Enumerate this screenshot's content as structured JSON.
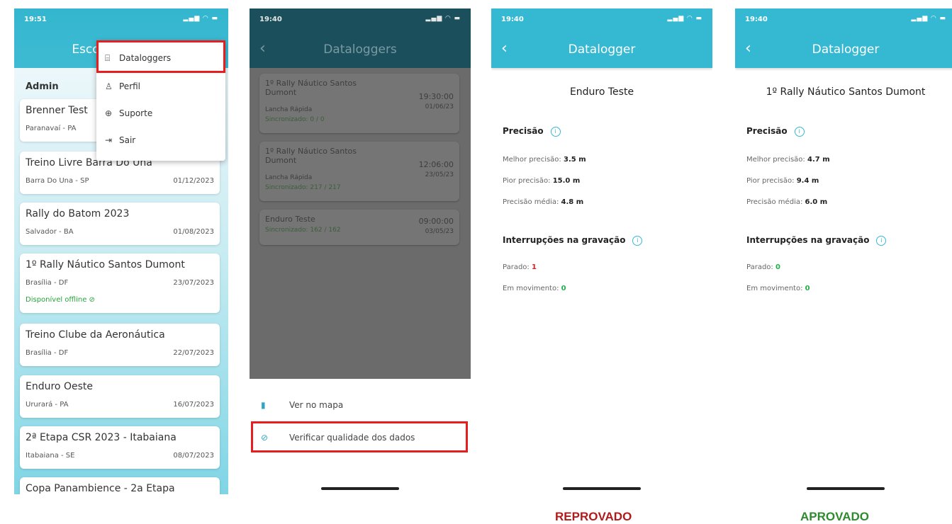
{
  "phone1": {
    "time": "19:51",
    "header_title": "Esco",
    "section": "Admin",
    "menu": [
      {
        "icon": "datalogger-icon",
        "label": "Dataloggers"
      },
      {
        "icon": "person-icon",
        "label": "Perfil"
      },
      {
        "icon": "support-icon",
        "label": "Suporte"
      },
      {
        "icon": "logout-icon",
        "label": "Sair"
      }
    ],
    "events": [
      {
        "title": "Brenner Test",
        "location": "Paranavaí - PA",
        "date": ""
      },
      {
        "title": "Treino Livre Barra Do Una",
        "location": "Barra Do Una - SP",
        "date": "01/12/2023"
      },
      {
        "title": "Rally do Batom 2023",
        "location": "Salvador - BA",
        "date": "01/08/2023"
      },
      {
        "title": "1º Rally Náutico Santos Dumont",
        "location": "Brasília - DF",
        "date": "23/07/2023",
        "offline": "Disponível offline"
      },
      {
        "title": "Treino Clube da Aeronáutica",
        "location": "Brasília - DF",
        "date": "22/07/2023"
      },
      {
        "title": "Enduro Oeste",
        "location": "Ururará - PA",
        "date": "16/07/2023"
      },
      {
        "title": "2ª Etapa CSR 2023 - Itabaiana",
        "location": "Itabaiana - SE",
        "date": "08/07/2023"
      },
      {
        "title": "Copa Panambience - 2a Etapa",
        "location": "",
        "date": ""
      }
    ]
  },
  "phone2": {
    "time": "19:40",
    "title": "Dataloggers",
    "items": [
      {
        "title": "1º Rally Náutico Santos Dumont",
        "vehicle": "Lancha Rápida",
        "sync": "Sincronizado: 0 / 0",
        "time": "19:30:00",
        "date": "01/06/23"
      },
      {
        "title": "1º Rally Náutico Santos Dumont",
        "vehicle": "Lancha Rápida",
        "sync": "Sincronizado: 217 / 217",
        "time": "12:06:00",
        "date": "23/05/23"
      },
      {
        "title": "Enduro Teste",
        "vehicle": "",
        "sync": "Sincronizado: 162 / 162",
        "time": "09:00:00",
        "date": "03/05/23"
      }
    ],
    "sheet": {
      "map": "Ver no mapa",
      "check": "Verificar qualidade dos dados"
    }
  },
  "phone3": {
    "time": "19:40",
    "title": "Datalogger",
    "name": "Enduro Teste",
    "precision_title": "Precisão",
    "best_label": "Melhor precisão:",
    "best": "3.5 m",
    "worst_label": "Pior precisão:",
    "worst": "15.0 m",
    "avg_label": "Precisão média:",
    "avg": "4.8 m",
    "interrupt_title": "Interrupções na gravação",
    "stopped_label": "Parado:",
    "stopped": "1",
    "moving_label": "Em movimento:",
    "moving": "0",
    "verdict": "REPROVADO"
  },
  "phone4": {
    "time": "19:40",
    "title": "Datalogger",
    "name": "1º Rally Náutico Santos Dumont",
    "precision_title": "Precisão",
    "best_label": "Melhor precisão:",
    "best": "4.7 m",
    "worst_label": "Pior precisão:",
    "worst": "9.4 m",
    "avg_label": "Precisão média:",
    "avg": "6.0 m",
    "interrupt_title": "Interrupções na gravação",
    "stopped_label": "Parado:",
    "stopped": "0",
    "moving_label": "Em movimento:",
    "moving": "0",
    "verdict": "APROVADO"
  },
  "colors": {
    "accent": "#35b8d1",
    "fail": "#b11a1a",
    "pass": "#2e8a2e",
    "highlight": "#e61e1e"
  }
}
